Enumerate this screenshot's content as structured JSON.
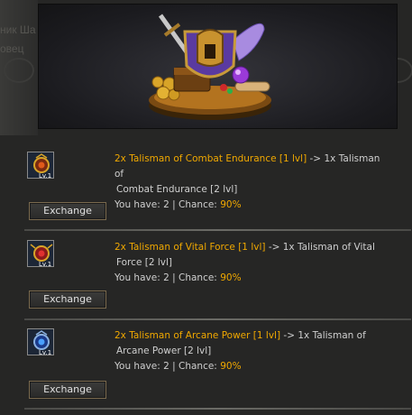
{
  "background": {
    "text_line1": "ник Ша",
    "text_line2": "овец"
  },
  "banner": {
    "art": "helmet-shield-treasure-emblem"
  },
  "items": [
    {
      "icon": "talisman-combat-endurance-icon",
      "qty_in": "2x",
      "name_in": "Talisman of Combat Endurance [1 lvl]",
      "arrow": "->",
      "qty_out": "1x",
      "name_out_a": "Talisman of",
      "name_out_b": "Combat Endurance [2 lvl]",
      "you_have_label": "You have:",
      "you_have": "2",
      "chance_label": "| Chance:",
      "chance": "90%",
      "level": "Lv.1",
      "button": "Exchange"
    },
    {
      "icon": "talisman-vital-force-icon",
      "qty_in": "2x",
      "name_in": "Talisman of Vital Force [1 lvl]",
      "arrow": "->",
      "qty_out": "1x",
      "name_out_a": "Talisman of Vital",
      "name_out_b": "Force [2 lvl]",
      "you_have_label": "You have:",
      "you_have": "2",
      "chance_label": "| Chance:",
      "chance": "90%",
      "level": "Lv.1",
      "button": "Exchange"
    },
    {
      "icon": "talisman-arcane-power-icon",
      "qty_in": "2x",
      "name_in": "Talisman of Arcane Power [1 lvl]",
      "arrow": "->",
      "qty_out": "1x",
      "name_out_a": "Talisman of",
      "name_out_b": "Arcane Power [2 lvl]",
      "you_have_label": "You have:",
      "you_have": "2",
      "chance_label": "| Chance:",
      "chance": "90%",
      "level": "Lv.1",
      "button": "Exchange"
    }
  ],
  "colors": {
    "gold": "#f0a800",
    "text": "#cfcfcf",
    "background": "#262625"
  }
}
